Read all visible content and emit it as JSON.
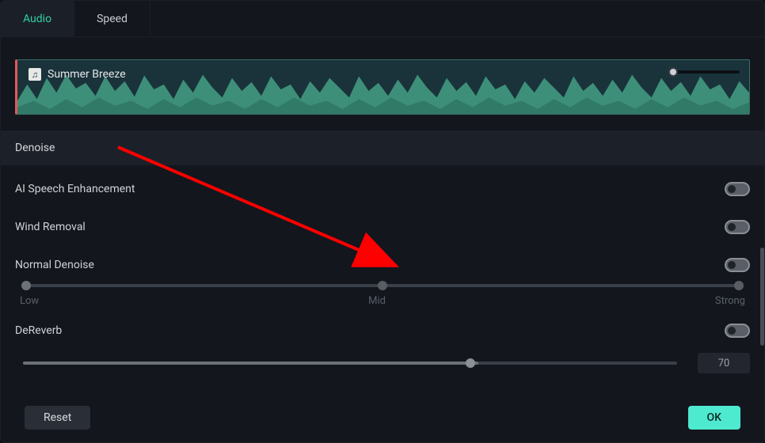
{
  "tabs": {
    "audio": "Audio",
    "speed": "Speed"
  },
  "track": {
    "name": "Summer Breeze"
  },
  "section": {
    "denoise_header": "Denoise"
  },
  "options": {
    "ai_speech": {
      "label": "AI Speech Enhancement",
      "on": false
    },
    "wind_removal": {
      "label": "Wind Removal",
      "on": false
    },
    "normal_denoise": {
      "label": "Normal Denoise",
      "on": false
    },
    "dereverb": {
      "label": "DeReverb",
      "on": false
    }
  },
  "slider_labels": {
    "low": "Low",
    "mid": "Mid",
    "strong": "Strong"
  },
  "dereverb_value": "70",
  "buttons": {
    "reset": "Reset",
    "ok": "OK"
  }
}
